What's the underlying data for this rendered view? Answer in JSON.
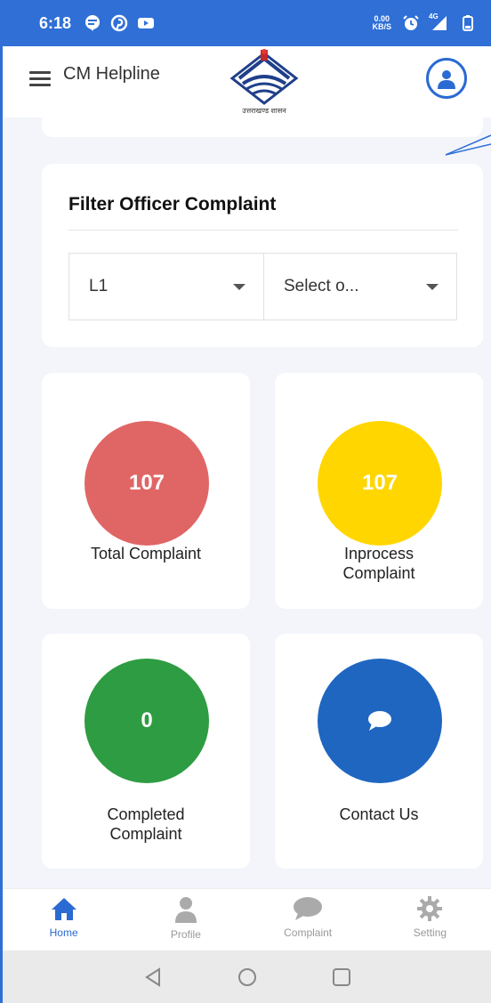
{
  "status_bar": {
    "time": "6:18",
    "net_speed_top": "0.00",
    "net_speed_bottom": "KB/S",
    "network_label": "4G",
    "icons_left": [
      "message-icon",
      "pinterest-icon",
      "youtube-icon"
    ],
    "icons_right": [
      "alarm-icon",
      "signal-icon",
      "battery-icon"
    ]
  },
  "appbar": {
    "title": "CM Helpline",
    "logo_caption": "उत्तराखण्ड शासन"
  },
  "filter": {
    "title": "Filter Officer Complaint",
    "level_value": "L1",
    "officer_value": "Select o..."
  },
  "tiles": [
    {
      "value": "107",
      "label_lines": [
        "Total Complaint"
      ],
      "color": "#e06666"
    },
    {
      "value": "107",
      "label_lines": [
        "Inprocess",
        "Complaint"
      ],
      "color": "#ffd600"
    },
    {
      "value": "0",
      "label_lines": [
        "Completed",
        "Complaint"
      ],
      "color": "#2e9c42"
    },
    {
      "value": "",
      "label_lines": [
        "Contact Us"
      ],
      "color": "#1f66c1",
      "icon": "chat-bubble-icon"
    }
  ],
  "bottom_nav": [
    {
      "label": "Home",
      "icon": "home-icon",
      "active": true
    },
    {
      "label": "Profile",
      "icon": "person-icon",
      "active": false
    },
    {
      "label": "Complaint",
      "icon": "chat-icon",
      "active": false
    },
    {
      "label": "Setting",
      "icon": "gear-icon",
      "active": false
    }
  ],
  "colors": {
    "primary": "#2a6ad3",
    "status_bar": "#2f6fd6",
    "background": "#f3f5fb",
    "inactive": "#999999"
  }
}
